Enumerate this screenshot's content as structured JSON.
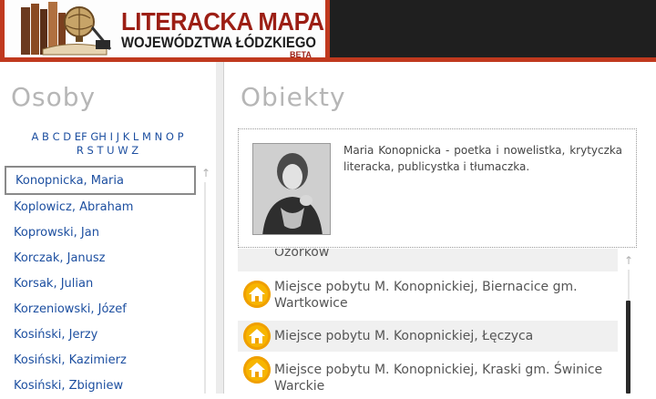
{
  "header": {
    "title_line1": "LITERACKA MAPA",
    "title_line2": "WOJEWÓDZTWA ŁÓDZKIEGO",
    "badge": "BETA",
    "accent_color": "#c0391e"
  },
  "persons_panel": {
    "title": "Osoby",
    "alphabet": [
      "A",
      "B",
      "C",
      "D",
      "E",
      "F",
      "G",
      "H",
      "I",
      "J",
      "K",
      "L",
      "M",
      "N",
      "O",
      "P",
      "R",
      "S",
      "T",
      "U",
      "W",
      "Z"
    ],
    "items": [
      {
        "label": "Konopnicka, Maria",
        "selected": true
      },
      {
        "label": "Koplowicz, Abraham"
      },
      {
        "label": "Koprowski, Jan"
      },
      {
        "label": "Korczak, Janusz"
      },
      {
        "label": "Korsak, Julian"
      },
      {
        "label": "Korzeniowski, Józef"
      },
      {
        "label": "Kosiński, Jerzy"
      },
      {
        "label": "Kosiński, Kazimierz"
      },
      {
        "label": "Kosiński, Zbigniew"
      }
    ]
  },
  "objects_panel": {
    "title": "Obiekty",
    "bio": "Maria Konopnicka - poetka i nowelistka, krytyczka literacka, publicystka i tłumaczka.",
    "places_partial": "Ozorków",
    "places": [
      {
        "line1": "Miejsce pobytu M. Konopnickiej, Biernacice gm.",
        "line2": "Wartkowice"
      },
      {
        "line1": "Miejsce pobytu M. Konopnickiej, Łęczyca",
        "line2": ""
      },
      {
        "line1": "Miejsce pobytu M. Konopnickiej, Kraski gm. Świnice",
        "line2": "Warckie"
      }
    ],
    "icon": "house-icon",
    "icon_color": "#f0a000"
  }
}
